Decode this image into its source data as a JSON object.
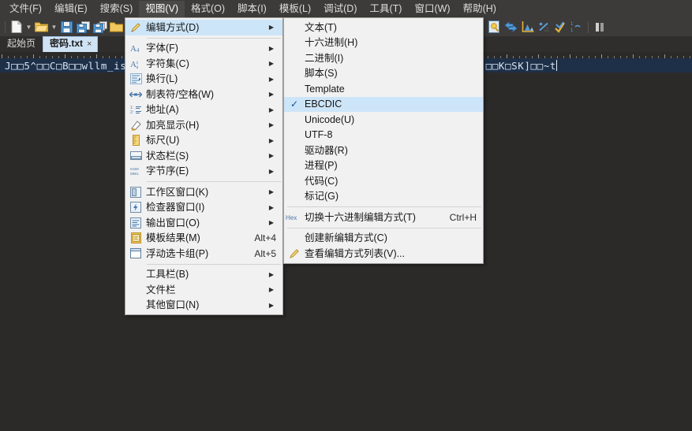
{
  "window": {
    "background": "#2b2a28",
    "chrome_color": "#3c3b39",
    "accent_highlight": "#cde5f8",
    "selection_color": "#1d3048"
  },
  "menubar": {
    "items": [
      {
        "label": "文件(F)",
        "active": false
      },
      {
        "label": "编辑(E)",
        "active": false
      },
      {
        "label": "搜索(S)",
        "active": false
      },
      {
        "label": "视图(V)",
        "active": true
      },
      {
        "label": "格式(O)",
        "active": false
      },
      {
        "label": "脚本(I)",
        "active": false
      },
      {
        "label": "模板(L)",
        "active": false
      },
      {
        "label": "调试(D)",
        "active": false
      },
      {
        "label": "工具(T)",
        "active": false
      },
      {
        "label": "窗口(W)",
        "active": false
      },
      {
        "label": "帮助(H)",
        "active": false
      }
    ]
  },
  "toolbar": {
    "left_icons": [
      "new-file-icon",
      "new-file-dropdown-icon",
      "open-folder-icon",
      "open-folder-dropdown-icon",
      "save-icon",
      "save-as-icon",
      "save-all-icon",
      "folder-icon"
    ],
    "right_icons": [
      "calculator-icon",
      "key-icon",
      "convert-arrows-icon",
      "chart-icon",
      "division-icon",
      "checkmark-chart-icon",
      "base-convert-icon",
      "pause-icon"
    ]
  },
  "tabs": [
    {
      "label": "起始页",
      "selected": false,
      "closable": false
    },
    {
      "label": "密码.txt",
      "selected": true,
      "closable": true,
      "close_glyph": "×"
    }
  ],
  "editor": {
    "line_left": "J□□5^□□C□B□□wllm_is",
    "line_right": "□□K□SK]□□~t",
    "caret_visible": true
  },
  "view_menu": {
    "name": "视图(V)",
    "items": [
      {
        "label": "编辑方式(D)",
        "icon": "pencil-icon",
        "arrow": true,
        "highlighted": true
      },
      {
        "separator": true
      },
      {
        "label": "字体(F)",
        "icon": "font-icon",
        "arrow": true
      },
      {
        "label": "字符集(C)",
        "icon": "charset-icon",
        "arrow": true
      },
      {
        "label": "换行(L)",
        "icon": "wrap-icon",
        "arrow": true
      },
      {
        "label": "制表符/空格(W)",
        "icon": "tab-space-icon",
        "arrow": true
      },
      {
        "label": "地址(A)",
        "icon": "address-list-icon",
        "arrow": true
      },
      {
        "label": "加亮显示(H)",
        "icon": "highlight-icon",
        "arrow": true
      },
      {
        "label": "标尺(U)",
        "icon": "ruler-icon",
        "arrow": true
      },
      {
        "label": "状态栏(S)",
        "icon": "statusbar-icon",
        "arrow": true
      },
      {
        "label": "字节序(E)",
        "icon": "byte-order-icon",
        "arrow": true
      },
      {
        "separator": true
      },
      {
        "label": "工作区窗口(K)",
        "icon": "workspace-window-icon",
        "arrow": true
      },
      {
        "label": "检查器窗口(I)",
        "icon": "inspector-window-icon",
        "arrow": true
      },
      {
        "label": "输出窗口(O)",
        "icon": "output-window-icon",
        "arrow": true
      },
      {
        "label": "模板结果(M)",
        "icon": "template-result-icon",
        "accel": "Alt+4"
      },
      {
        "label": "浮动选卡组(P)",
        "icon": "floating-tabs-icon",
        "accel": "Alt+5"
      },
      {
        "separator": true
      },
      {
        "label": "工具栏(B)",
        "icon": "",
        "arrow": true
      },
      {
        "label": "文件栏",
        "icon": "",
        "arrow": true
      },
      {
        "label": "其他窗口(N)",
        "icon": "",
        "arrow": true
      }
    ]
  },
  "edit_mode_submenu": {
    "name": "编辑方式(D)",
    "items": [
      {
        "label": "文本(T)"
      },
      {
        "label": "十六进制(H)"
      },
      {
        "label": "二进制(I)"
      },
      {
        "label": "脚本(S)"
      },
      {
        "label": "Template"
      },
      {
        "label": "EBCDIC",
        "checked": true,
        "highlighted": true
      },
      {
        "label": "Unicode(U)"
      },
      {
        "label": "UTF-8"
      },
      {
        "label": "驱动器(R)"
      },
      {
        "label": "进程(P)"
      },
      {
        "label": "代码(C)"
      },
      {
        "label": "标记(G)"
      },
      {
        "separator": true
      },
      {
        "label": "切换十六进制编辑方式(T)",
        "icon": "hex-icon",
        "accel": "Ctrl+H"
      },
      {
        "separator": true
      },
      {
        "label": "创建新编辑方式(C)"
      },
      {
        "label": "查看编辑方式列表(V)...",
        "icon": "pencil-icon"
      }
    ]
  }
}
